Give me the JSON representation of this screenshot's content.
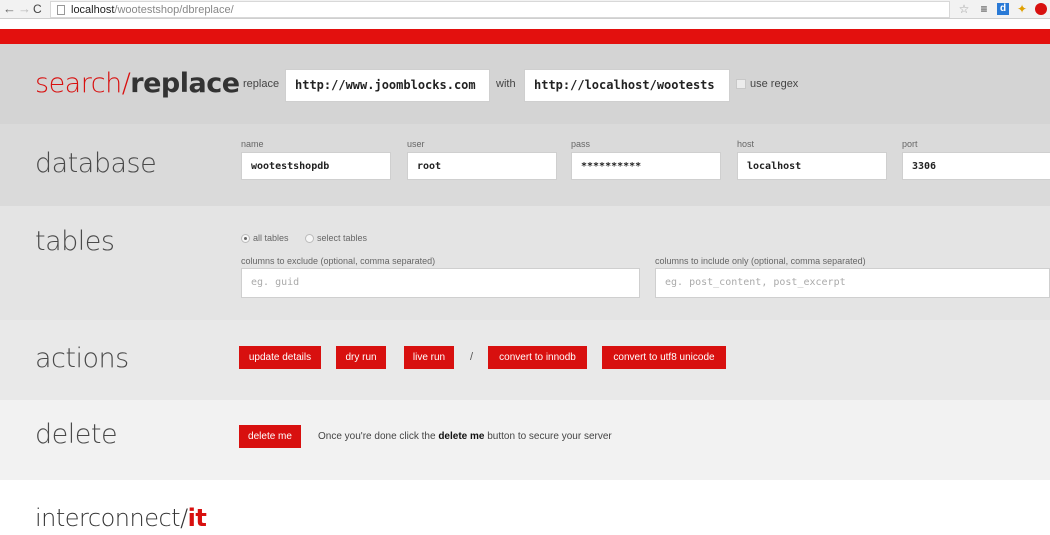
{
  "browser": {
    "url_host": "localhost",
    "url_path": "/wootestshop/dbreplace/"
  },
  "search_replace": {
    "title_part1": "search/",
    "title_part2": "replace",
    "replace_label": "replace",
    "replace_value": "http://www.joomblocks.com",
    "with_label": "with",
    "with_value": "http://localhost/wootests",
    "regex_label": "use regex"
  },
  "database": {
    "title": "database",
    "fields": [
      {
        "label": "name",
        "value": "wootestshopdb"
      },
      {
        "label": "user",
        "value": "root"
      },
      {
        "label": "pass",
        "value": "**********"
      },
      {
        "label": "host",
        "value": "localhost"
      },
      {
        "label": "port",
        "value": "3306"
      }
    ]
  },
  "tables": {
    "title": "tables",
    "all_tables": "all tables",
    "select_tables": "select tables",
    "exclude_label": "columns to exclude (optional, comma separated)",
    "exclude_placeholder": "eg. guid",
    "include_label": "columns to include only (optional, comma separated)",
    "include_placeholder": "eg. post_content, post_excerpt"
  },
  "actions": {
    "title": "actions",
    "update": "update details",
    "dry": "dry run",
    "live": "live run",
    "separator": "/",
    "innodb": "convert to innodb",
    "utf8": "convert to utf8 unicode"
  },
  "delete": {
    "title": "delete",
    "button": "delete me",
    "text_before": "Once you're done click the ",
    "text_bold": "delete me",
    "text_after": " button to secure your server"
  },
  "footer": {
    "brand_part1": "interconnect/",
    "brand_part2": "it"
  },
  "colors": {
    "accent": "#d8100f"
  }
}
